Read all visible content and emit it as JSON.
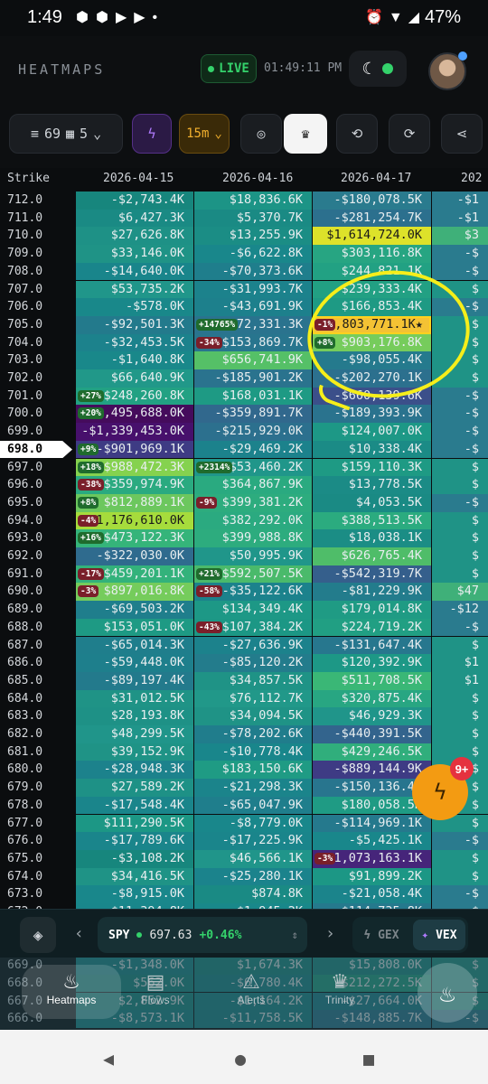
{
  "status": {
    "time": "1:49",
    "battery": "47%"
  },
  "header": {
    "brand": "HEATMAPS",
    "live": "LIVE",
    "clock": "01:49:11 PM"
  },
  "toolbar": {
    "strikes": "69",
    "days": "5",
    "interval": "15m"
  },
  "columns": [
    "Strike",
    "2026-04-15",
    "2026-04-16",
    "2026-04-17",
    "202"
  ],
  "current_strike": "698.0",
  "rows": [
    {
      "s": "712.0",
      "c": [
        [
          "-$2,743.4K",
          "#17867d"
        ],
        [
          "$18,836.6K",
          "#1c9486"
        ],
        [
          "-$180,078.5K",
          "#2a7b8e"
        ],
        [
          "-$1",
          "#2a7b8e"
        ]
      ]
    },
    {
      "s": "711.0",
      "c": [
        [
          "$6,427.3K",
          "#1a8a84"
        ],
        [
          "$5,370.7K",
          "#1a8a84"
        ],
        [
          "-$281,254.7K",
          "#2c708e"
        ],
        [
          "-$1",
          "#2a7b8e"
        ]
      ]
    },
    {
      "s": "710.0",
      "c": [
        [
          "$27,626.8K",
          "#1e9186"
        ],
        [
          "$13,255.9K",
          "#1b8d85"
        ],
        [
          "$1,614,724.0K",
          "#dde22a"
        ],
        [
          "$3",
          "#3fb079"
        ]
      ]
    },
    {
      "s": "709.0",
      "c": [
        [
          "$33,146.0K",
          "#1f9386"
        ],
        [
          "-$6,622.8K",
          "#19878b"
        ],
        [
          "$303,116.8K",
          "#27a582"
        ],
        [
          "-$",
          "#2a7b8e"
        ]
      ]
    },
    {
      "s": "708.0",
      "c": [
        [
          "-$14,640.0K",
          "#19858b"
        ],
        [
          "-$70,373.6K",
          "#1f7e8c"
        ],
        [
          "$244,821.1K",
          "#22a183"
        ],
        [
          "-$",
          "#2a7b8e"
        ]
      ]
    },
    {
      "s": "707.0",
      "c": [
        [
          "$53,735.2K",
          "#20968a"
        ],
        [
          "-$31,993.7K",
          "#1c828c"
        ],
        [
          "$239,333.4K",
          "#22a083"
        ],
        [
          "$",
          "#1f9386"
        ]
      ]
    },
    {
      "s": "706.0",
      "c": [
        [
          "-$578.0K",
          "#19888a"
        ],
        [
          "-$43,691.9K",
          "#1d808c"
        ],
        [
          "$166,853.4K",
          "#1e9a84"
        ],
        [
          "-$",
          "#2a7b8e"
        ]
      ]
    },
    {
      "s": "705.0",
      "c": [
        [
          "-$92,501.3K",
          "#237a8c"
        ],
        [
          "-$172,331.3K",
          "#2a738e",
          "+14765%",
          "up"
        ],
        [
          "-$1,803,771.1K★",
          "#f4c234",
          "-1%",
          "dn"
        ],
        [
          "$",
          "#1f9386"
        ]
      ]
    },
    {
      "s": "704.0",
      "c": [
        [
          "-$32,453.5K",
          "#1c828c"
        ],
        [
          "-$153,869.7K",
          "#28758e",
          "-34%",
          "dn"
        ],
        [
          "$903,176.8K",
          "#76cc5c",
          "+8%",
          "up"
        ],
        [
          "$",
          "#1f9386"
        ]
      ]
    },
    {
      "s": "703.0",
      "c": [
        [
          "-$1,640.8K",
          "#19888a"
        ],
        [
          "$656,741.9K",
          "#55c067"
        ],
        [
          "-$98,055.4K",
          "#257a8d"
        ],
        [
          "$",
          "#1f9386"
        ]
      ]
    },
    {
      "s": "702.0",
      "c": [
        [
          "$66,640.9K",
          "#219889"
        ],
        [
          "-$185,901.2K",
          "#2a738e"
        ],
        [
          "-$202,270.1K",
          "#2c708e"
        ],
        [
          "$",
          "#1f9386"
        ]
      ]
    },
    {
      "s": "701.0",
      "c": [
        [
          "$248,260.8K",
          "#22a183",
          "+27%",
          "up"
        ],
        [
          "$168,031.1K",
          "#1e9a84"
        ],
        [
          "-$660,139.6K",
          "#3b4f8a"
        ],
        [
          "-$",
          "#2a7b8e"
        ]
      ]
    },
    {
      "s": "700.0",
      "c": [
        [
          "-$1,495,688.0K",
          "#450b5c",
          "+20%",
          "up"
        ],
        [
          "-$359,891.7K",
          "#31688d"
        ],
        [
          "-$189,393.9K",
          "#2a738e"
        ],
        [
          "-$",
          "#2a7b8e"
        ]
      ]
    },
    {
      "s": "699.0",
      "c": [
        [
          "-$1,339,453.0K",
          "#47106c"
        ],
        [
          "-$215,929.0K",
          "#2c708e"
        ],
        [
          "$124,007.0K",
          "#1d9886"
        ],
        [
          "-$",
          "#2a7b8e"
        ]
      ]
    },
    {
      "s": "698.0",
      "c": [
        [
          "-$901,969.1K",
          "#3e3b84",
          "+9%",
          "up"
        ],
        [
          "-$29,469.2K",
          "#1c828c"
        ],
        [
          "$10,338.4K",
          "#1b8b86"
        ],
        [
          "-$",
          "#2a7b8e"
        ]
      ]
    },
    {
      "s": "697.0",
      "c": [
        [
          "$988,472.3K",
          "#85d24f",
          "+18%",
          "up"
        ],
        [
          "$53,460.2K",
          "#20968a",
          "+2314%",
          "up"
        ],
        [
          "$159,110.3K",
          "#1e9a84"
        ],
        [
          "$",
          "#1f9386"
        ]
      ]
    },
    {
      "s": "696.0",
      "c": [
        [
          "$359,974.9K",
          "#2aaa80",
          "-38%",
          "dn"
        ],
        [
          "$364,867.9K",
          "#2aaa80"
        ],
        [
          "$13,778.5K",
          "#1b8b86"
        ],
        [
          "$",
          "#1f9386"
        ]
      ]
    },
    {
      "s": "695.0",
      "c": [
        [
          "$812,889.1K",
          "#6cc75e",
          "+8%",
          "up"
        ],
        [
          "$399,381.2K",
          "#2dac7e",
          "-9%",
          "dn"
        ],
        [
          "$4,053.5K",
          "#1a8a84"
        ],
        [
          "-$",
          "#2a7b8e"
        ]
      ]
    },
    {
      "s": "694.0",
      "c": [
        [
          "$1,176,610.0K",
          "#a6dc3c",
          "-4%",
          "dn"
        ],
        [
          "$382,292.0K",
          "#2baa80"
        ],
        [
          "$388,513.5K",
          "#2bab7f"
        ],
        [
          "$",
          "#1f9386"
        ]
      ]
    },
    {
      "s": "693.0",
      "c": [
        [
          "$473,122.3K",
          "#35b47a",
          "+16%",
          "up"
        ],
        [
          "$399,988.8K",
          "#2dac7e"
        ],
        [
          "$18,038.1K",
          "#1b8d85"
        ],
        [
          "$",
          "#1f9386"
        ]
      ]
    },
    {
      "s": "692.0",
      "c": [
        [
          "-$322,030.0K",
          "#2f6b8e"
        ],
        [
          "$50,995.9K",
          "#20968a"
        ],
        [
          "$626,765.4K",
          "#4fbd69"
        ],
        [
          "$",
          "#1f9386"
        ]
      ]
    },
    {
      "s": "691.0",
      "c": [
        [
          "$459,201.1K",
          "#33b27b",
          "-17%",
          "dn"
        ],
        [
          "$592,507.5K",
          "#4aba6b",
          "+21%",
          "up"
        ],
        [
          "-$542,319.7K",
          "#355f8c"
        ],
        [
          "$",
          "#1f9386"
        ]
      ]
    },
    {
      "s": "690.0",
      "c": [
        [
          "$897,016.8K",
          "#75cc5c",
          "-3%",
          "dn"
        ],
        [
          "-$35,122.6K",
          "#1c828c",
          "-58%",
          "dn"
        ],
        [
          "-$81,229.9K",
          "#237c8c"
        ],
        [
          "$47",
          "#3fb079"
        ]
      ]
    },
    {
      "s": "689.0",
      "c": [
        [
          "-$69,503.2K",
          "#1f7e8c"
        ],
        [
          "$134,349.4K",
          "#1d9886"
        ],
        [
          "$179,014.8K",
          "#1f9b84"
        ],
        [
          "-$12",
          "#2a7b8e"
        ]
      ]
    },
    {
      "s": "688.0",
      "c": [
        [
          "$153,051.0K",
          "#1e9a84"
        ],
        [
          "$107,384.2K",
          "#1c9785",
          "-43%",
          "dn"
        ],
        [
          "$224,719.2K",
          "#219f83"
        ],
        [
          "-$",
          "#2a7b8e"
        ]
      ]
    },
    {
      "s": "687.0",
      "c": [
        [
          "-$65,014.3K",
          "#1f7e8c"
        ],
        [
          "-$27,636.9K",
          "#1c828c"
        ],
        [
          "-$131,647.4K",
          "#27778e"
        ],
        [
          "$",
          "#1f9386"
        ]
      ]
    },
    {
      "s": "686.0",
      "c": [
        [
          "-$59,448.0K",
          "#1e7f8c"
        ],
        [
          "-$85,120.2K",
          "#237c8c"
        ],
        [
          "$120,392.9K",
          "#1d9886"
        ],
        [
          "$1",
          "#1f9386"
        ]
      ]
    },
    {
      "s": "685.0",
      "c": [
        [
          "-$89,197.4K",
          "#237a8c"
        ],
        [
          "$34,857.5K",
          "#1f9386"
        ],
        [
          "$511,708.5K",
          "#3ab776"
        ],
        [
          "$1",
          "#1f9386"
        ]
      ]
    },
    {
      "s": "684.0",
      "c": [
        [
          "$31,012.5K",
          "#1f9386"
        ],
        [
          "$76,112.7K",
          "#219889"
        ],
        [
          "$320,875.4K",
          "#28a682"
        ],
        [
          "$",
          "#1f9386"
        ]
      ]
    },
    {
      "s": "683.0",
      "c": [
        [
          "$28,193.8K",
          "#1e9186"
        ],
        [
          "$34,094.5K",
          "#1f9386"
        ],
        [
          "$46,929.3K",
          "#20958a"
        ],
        [
          "$",
          "#1f9386"
        ]
      ]
    },
    {
      "s": "682.0",
      "c": [
        [
          "$48,299.5K",
          "#20958a"
        ],
        [
          "-$78,202.6K",
          "#207d8c"
        ],
        [
          "-$440,391.5K",
          "#33648d"
        ],
        [
          "$",
          "#1f9386"
        ]
      ]
    },
    {
      "s": "681.0",
      "c": [
        [
          "$39,152.9K",
          "#1f9386"
        ],
        [
          "-$10,778.4K",
          "#19868b"
        ],
        [
          "$429,246.5K",
          "#30ae7c"
        ],
        [
          "$",
          "#1f9386"
        ]
      ]
    },
    {
      "s": "680.0",
      "c": [
        [
          "-$28,948.3K",
          "#1c828c"
        ],
        [
          "$183,150.6K",
          "#1f9b84"
        ],
        [
          "-$889,144.9K",
          "#3e3b84"
        ],
        [
          "$",
          "#1f9386"
        ]
      ]
    },
    {
      "s": "679.0",
      "c": [
        [
          "$27,589.2K",
          "#1e9186"
        ],
        [
          "-$21,298.3K",
          "#1b848b"
        ],
        [
          "-$150,136.4K",
          "#28758e"
        ],
        [
          "$",
          "#1f9386"
        ]
      ]
    },
    {
      "s": "678.0",
      "c": [
        [
          "-$17,548.4K",
          "#1a858b"
        ],
        [
          "-$65,047.9K",
          "#1f7e8c"
        ],
        [
          "$180,058.5K",
          "#1f9b84"
        ],
        [
          "$",
          "#1f9386"
        ]
      ]
    },
    {
      "s": "677.0",
      "c": [
        [
          "$111,290.5K",
          "#1c9785"
        ],
        [
          "-$8,779.0K",
          "#19878b"
        ],
        [
          "-$114,969.1K",
          "#25798d"
        ],
        [
          "$",
          "#1f9386"
        ]
      ]
    },
    {
      "s": "676.0",
      "c": [
        [
          "-$17,789.6K",
          "#1a858b"
        ],
        [
          "-$17,225.9K",
          "#1a858b"
        ],
        [
          "-$5,425.1K",
          "#19878b"
        ],
        [
          "-$",
          "#2a7b8e"
        ]
      ]
    },
    {
      "s": "675.0",
      "c": [
        [
          "-$3,108.2K",
          "#17867d"
        ],
        [
          "$46,566.1K",
          "#20958a"
        ],
        [
          "-$1,073,163.1K",
          "#46257a",
          "-3%",
          "dn"
        ],
        [
          "$",
          "#1f9386"
        ]
      ]
    },
    {
      "s": "674.0",
      "c": [
        [
          "$34,416.5K",
          "#1f9386"
        ],
        [
          "-$25,280.1K",
          "#1b838c"
        ],
        [
          "$91,899.2K",
          "#1c9785"
        ],
        [
          "$",
          "#1f9386"
        ]
      ]
    },
    {
      "s": "673.0",
      "c": [
        [
          "-$8,915.0K",
          "#19878b"
        ],
        [
          "$874.8K",
          "#1a8a84"
        ],
        [
          "-$21,058.4K",
          "#1b848b"
        ],
        [
          "-$",
          "#2a7b8e"
        ]
      ]
    },
    {
      "s": "672.0",
      "c": [
        [
          "-$11,394.8K",
          "#19868b"
        ],
        [
          "-$1,945.2K",
          "#19888a"
        ],
        [
          "-$114,735.8K",
          "#25798d"
        ],
        [
          "-$",
          "#2a7b8e"
        ]
      ]
    },
    {
      "s": "671.0",
      "c": [
        [
          "$4,112.5K",
          "#1a8a84"
        ],
        [
          "$2,004.3K",
          "#1a8a84"
        ],
        [
          "-$31,506.2K",
          "#1c828c"
        ],
        [
          "$",
          "#1f9386"
        ]
      ]
    },
    {
      "s": "670.0",
      "c": [
        [
          "-$7,225.1K",
          "#19878b"
        ],
        [
          "$6,390.7K",
          "#1a8a84"
        ],
        [
          "$18,402.9K",
          "#1b8d85"
        ],
        [
          "$",
          "#1f9386"
        ]
      ]
    },
    {
      "s": "669.0",
      "c": [
        [
          "-$1,348.0K",
          "#19888a"
        ],
        [
          "$1,674.3K",
          "#1a8a84"
        ],
        [
          "$15,808.0K",
          "#1b8d85"
        ],
        [
          "$",
          "#1f9386"
        ]
      ]
    },
    {
      "s": "668.0",
      "c": [
        [
          "$562.0K",
          "#1a8a84"
        ],
        [
          "-$6,780.4K",
          "#19878b"
        ],
        [
          "$212,272.5K",
          "#219f83"
        ],
        [
          "$",
          "#1f9386"
        ]
      ]
    },
    {
      "s": "667.0",
      "c": [
        [
          "$2,852.9K",
          "#1a8a84"
        ],
        [
          "-$1,164.2K",
          "#19888a"
        ],
        [
          "-$27,664.0K",
          "#1c828c"
        ],
        [
          "$",
          "#1f9386"
        ]
      ]
    },
    {
      "s": "666.0",
      "c": [
        [
          "-$8,573.1K",
          "#19878b"
        ],
        [
          "-$11,758.5K",
          "#19868b"
        ],
        [
          "-$148,885.7K",
          "#28758e"
        ],
        [
          "-$",
          "#2a7b8e"
        ]
      ]
    }
  ],
  "ticker": {
    "symbol": "SPY",
    "price": "697.63",
    "change": "+0.46%"
  },
  "toggle": {
    "gex": "GEX",
    "vex": "VEX"
  },
  "fab_badge": "9+",
  "nav": {
    "heatmaps": "Heatmaps",
    "nav2": "Flows",
    "nav3": "Alerts",
    "trinity": "Trinity"
  },
  "colors": {
    "accent": "#34d26b",
    "highlight": "#f6ee1a",
    "fab": "#f39b12"
  }
}
